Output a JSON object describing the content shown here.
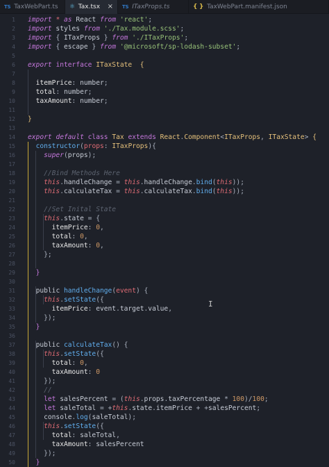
{
  "tabs": [
    {
      "name": "tab-taxwebpart",
      "icon": "ts-file-icon",
      "icon_text": "TS",
      "label": "TaxWebPart.ts",
      "active": false,
      "italic": false
    },
    {
      "name": "tab-tax-tsx",
      "icon": "react-file-icon",
      "icon_text": "⚛",
      "label": "Tax.tsx",
      "active": true,
      "italic": false,
      "close": "×"
    },
    {
      "name": "tab-itaxprops",
      "icon": "ts-file-icon",
      "icon_text": "TS",
      "label": "ITaxProps.ts",
      "active": false,
      "italic": true
    },
    {
      "name": "tab-manifest",
      "icon": "json-file-icon",
      "icon_text": "{ }",
      "label": "TaxWebPart.manifest.json",
      "active": false,
      "italic": false
    }
  ],
  "editor": {
    "line_numbers": [
      "1",
      "2",
      "3",
      "4",
      "5",
      "6",
      "7",
      "8",
      "9",
      "10",
      "11",
      "12",
      "13",
      "14",
      "15",
      "16",
      "17",
      "18",
      "19",
      "20",
      "21",
      "22",
      "23",
      "24",
      "25",
      "26",
      "27",
      "28",
      "29",
      "30",
      "31",
      "32",
      "33",
      "34",
      "35",
      "36",
      "37",
      "38",
      "39",
      "40",
      "41",
      "42",
      "43",
      "44",
      "45",
      "46",
      "47",
      "48",
      "49",
      "50"
    ],
    "lines": [
      [
        [
          "kwi",
          "import"
        ],
        [
          "pl",
          " "
        ],
        [
          "id",
          "*"
        ],
        [
          "pl",
          " "
        ],
        [
          "kwi",
          "as"
        ],
        [
          "pl",
          " React "
        ],
        [
          "kwi",
          "from"
        ],
        [
          "pl",
          " "
        ],
        [
          "str",
          "'react'"
        ],
        [
          "pun",
          ";"
        ]
      ],
      [
        [
          "kwi",
          "import"
        ],
        [
          "pl",
          " styles "
        ],
        [
          "kwi",
          "from"
        ],
        [
          "pl",
          " "
        ],
        [
          "str",
          "'./Tax.module.scss'"
        ],
        [
          "pun",
          ";"
        ]
      ],
      [
        [
          "kwi",
          "import"
        ],
        [
          "pl",
          " "
        ],
        [
          "pun",
          "{"
        ],
        [
          "pl",
          " ITaxProps "
        ],
        [
          "pun",
          "}"
        ],
        [
          "pl",
          " "
        ],
        [
          "kwi",
          "from"
        ],
        [
          "pl",
          " "
        ],
        [
          "str",
          "'./ITaxProps'"
        ],
        [
          "pun",
          ";"
        ]
      ],
      [
        [
          "kwi",
          "import"
        ],
        [
          "pl",
          " "
        ],
        [
          "pun",
          "{"
        ],
        [
          "pl",
          " escape "
        ],
        [
          "pun",
          "}"
        ],
        [
          "pl",
          " "
        ],
        [
          "kwi",
          "from"
        ],
        [
          "pl",
          " "
        ],
        [
          "str",
          "'@microsoft/sp-lodash-subset'"
        ],
        [
          "pun",
          ";"
        ]
      ],
      [],
      [
        [
          "kwi",
          "export"
        ],
        [
          "pl",
          " "
        ],
        [
          "kw",
          "interface"
        ],
        [
          "pl",
          " "
        ],
        [
          "ty",
          "ITaxState"
        ],
        [
          "pl",
          "  "
        ],
        [
          "ty",
          "{"
        ]
      ],
      [],
      [
        [
          "pl",
          "  "
        ],
        [
          "prop",
          "itemPrice"
        ],
        [
          "pun",
          ":"
        ],
        [
          "pl",
          " "
        ],
        [
          "pl",
          "number"
        ],
        [
          "pun",
          ";"
        ]
      ],
      [
        [
          "pl",
          "  "
        ],
        [
          "prop",
          "total"
        ],
        [
          "pun",
          ":"
        ],
        [
          "pl",
          " "
        ],
        [
          "pl",
          "number"
        ],
        [
          "pun",
          ";"
        ]
      ],
      [
        [
          "pl",
          "  "
        ],
        [
          "prop",
          "taxAmount"
        ],
        [
          "pun",
          ":"
        ],
        [
          "pl",
          " "
        ],
        [
          "pl",
          "number"
        ],
        [
          "pun",
          ";"
        ]
      ],
      [],
      [
        [
          "ty",
          "}"
        ]
      ],
      [],
      [
        [
          "kwi",
          "export"
        ],
        [
          "pl",
          " "
        ],
        [
          "kwi",
          "default"
        ],
        [
          "pl",
          " "
        ],
        [
          "kw",
          "class"
        ],
        [
          "pl",
          " "
        ],
        [
          "cls",
          "Tax"
        ],
        [
          "pl",
          " "
        ],
        [
          "kw",
          "extends"
        ],
        [
          "pl",
          " "
        ],
        [
          "cls",
          "React"
        ],
        [
          "pun",
          "."
        ],
        [
          "cls",
          "Component"
        ],
        [
          "pun",
          "<"
        ],
        [
          "cls",
          "ITaxProps"
        ],
        [
          "pun",
          ","
        ],
        [
          "pl",
          " "
        ],
        [
          "cls",
          "ITaxState"
        ],
        [
          "pun",
          ">"
        ],
        [
          "pl",
          " "
        ],
        [
          "ty",
          "{"
        ]
      ],
      [
        [
          "pl",
          "  "
        ],
        [
          "fn",
          "constructor"
        ],
        [
          "pun",
          "("
        ],
        [
          "par",
          "props"
        ],
        [
          "pun",
          ":"
        ],
        [
          "pl",
          " "
        ],
        [
          "cls",
          "ITaxProps"
        ],
        [
          "pun",
          "){"
        ]
      ],
      [
        [
          "pl",
          "    "
        ],
        [
          "kwi",
          "super"
        ],
        [
          "pun",
          "("
        ],
        [
          "pl",
          "props"
        ],
        [
          "pun",
          ");"
        ]
      ],
      [],
      [
        [
          "pl",
          "    "
        ],
        [
          "com",
          "//Bind Methods Here"
        ]
      ],
      [
        [
          "pl",
          "    "
        ],
        [
          "idi",
          "this"
        ],
        [
          "pun",
          "."
        ],
        [
          "pl",
          "handleChange "
        ],
        [
          "pun",
          "="
        ],
        [
          "pl",
          " "
        ],
        [
          "idi",
          "this"
        ],
        [
          "pun",
          "."
        ],
        [
          "pl",
          "handleChange"
        ],
        [
          "pun",
          "."
        ],
        [
          "fn",
          "bind"
        ],
        [
          "pun",
          "("
        ],
        [
          "idi",
          "this"
        ],
        [
          "pun",
          "));"
        ]
      ],
      [
        [
          "pl",
          "    "
        ],
        [
          "idi",
          "this"
        ],
        [
          "pun",
          "."
        ],
        [
          "pl",
          "calculateTax "
        ],
        [
          "pun",
          "="
        ],
        [
          "pl",
          " "
        ],
        [
          "idi",
          "this"
        ],
        [
          "pun",
          "."
        ],
        [
          "pl",
          "calculateTax"
        ],
        [
          "pun",
          "."
        ],
        [
          "fn",
          "bind"
        ],
        [
          "pun",
          "("
        ],
        [
          "idi",
          "this"
        ],
        [
          "pun",
          "));"
        ]
      ],
      [],
      [
        [
          "pl",
          "    "
        ],
        [
          "com",
          "//Set Inital State"
        ]
      ],
      [
        [
          "pl",
          "    "
        ],
        [
          "idi",
          "this"
        ],
        [
          "pun",
          "."
        ],
        [
          "pl",
          "state "
        ],
        [
          "pun",
          "= {"
        ]
      ],
      [
        [
          "pl",
          "      "
        ],
        [
          "prop",
          "itemPrice"
        ],
        [
          "pun",
          ":"
        ],
        [
          "pl",
          " "
        ],
        [
          "num",
          "0"
        ],
        [
          "pun",
          ","
        ]
      ],
      [
        [
          "pl",
          "      "
        ],
        [
          "prop",
          "total"
        ],
        [
          "pun",
          ":"
        ],
        [
          "pl",
          " "
        ],
        [
          "num",
          "0"
        ],
        [
          "pun",
          ","
        ]
      ],
      [
        [
          "pl",
          "      "
        ],
        [
          "prop",
          "taxAmount"
        ],
        [
          "pun",
          ":"
        ],
        [
          "pl",
          " "
        ],
        [
          "num",
          "0"
        ],
        [
          "pun",
          ","
        ]
      ],
      [
        [
          "pl",
          "    "
        ],
        [
          "pun",
          "};"
        ]
      ],
      [],
      [
        [
          "pl",
          "  "
        ],
        [
          "kw",
          "}"
        ]
      ],
      [],
      [
        [
          "pl",
          "  "
        ],
        [
          "pl",
          "public "
        ],
        [
          "fn",
          "handleChange"
        ],
        [
          "pun",
          "("
        ],
        [
          "par",
          "event"
        ],
        [
          "pun",
          ") {"
        ]
      ],
      [
        [
          "pl",
          "    "
        ],
        [
          "idi",
          "this"
        ],
        [
          "pun",
          "."
        ],
        [
          "fn",
          "setState"
        ],
        [
          "pun",
          "({"
        ]
      ],
      [
        [
          "pl",
          "      "
        ],
        [
          "prop",
          "itemPrice"
        ],
        [
          "pun",
          ":"
        ],
        [
          "pl",
          " event"
        ],
        [
          "pun",
          "."
        ],
        [
          "pl",
          "target"
        ],
        [
          "pun",
          "."
        ],
        [
          "pl",
          "value"
        ],
        [
          "pun",
          ","
        ]
      ],
      [
        [
          "pl",
          "    "
        ],
        [
          "pun",
          "});"
        ]
      ],
      [
        [
          "pl",
          "  "
        ],
        [
          "kw",
          "}"
        ]
      ],
      [],
      [
        [
          "pl",
          "  "
        ],
        [
          "pl",
          "public "
        ],
        [
          "fn",
          "calculateTax"
        ],
        [
          "pun",
          "() {"
        ]
      ],
      [
        [
          "pl",
          "    "
        ],
        [
          "idi",
          "this"
        ],
        [
          "pun",
          "."
        ],
        [
          "fn",
          "setState"
        ],
        [
          "pun",
          "({"
        ]
      ],
      [
        [
          "pl",
          "      "
        ],
        [
          "prop",
          "total"
        ],
        [
          "pun",
          ":"
        ],
        [
          "pl",
          " "
        ],
        [
          "num",
          "0"
        ],
        [
          "pun",
          ","
        ]
      ],
      [
        [
          "pl",
          "      "
        ],
        [
          "prop",
          "taxAmount"
        ],
        [
          "pun",
          ":"
        ],
        [
          "pl",
          " "
        ],
        [
          "num",
          "0"
        ]
      ],
      [
        [
          "pl",
          "    "
        ],
        [
          "pun",
          "});"
        ]
      ],
      [
        [
          "pl",
          "    "
        ],
        [
          "com",
          "//"
        ]
      ],
      [
        [
          "pl",
          "    "
        ],
        [
          "kw",
          "let"
        ],
        [
          "pl",
          " salesPercent "
        ],
        [
          "pun",
          "="
        ],
        [
          "pl",
          " "
        ],
        [
          "pun",
          "("
        ],
        [
          "idi",
          "this"
        ],
        [
          "pun",
          "."
        ],
        [
          "pl",
          "props"
        ],
        [
          "pun",
          "."
        ],
        [
          "pl",
          "taxPercentage "
        ],
        [
          "pun",
          "*"
        ],
        [
          "pl",
          " "
        ],
        [
          "num",
          "100"
        ],
        [
          "pun",
          ")/"
        ],
        [
          "num",
          "100"
        ],
        [
          "pun",
          ";"
        ]
      ],
      [
        [
          "pl",
          "    "
        ],
        [
          "kw",
          "let"
        ],
        [
          "pl",
          " saleTotal "
        ],
        [
          "pun",
          "="
        ],
        [
          "pl",
          " "
        ],
        [
          "pun",
          "+"
        ],
        [
          "idi",
          "this"
        ],
        [
          "pun",
          "."
        ],
        [
          "pl",
          "state"
        ],
        [
          "pun",
          "."
        ],
        [
          "pl",
          "itemPrice "
        ],
        [
          "pun",
          "+"
        ],
        [
          "pl",
          " "
        ],
        [
          "pun",
          "+"
        ],
        [
          "pl",
          "salesPercent"
        ],
        [
          "pun",
          ";"
        ]
      ],
      [
        [
          "pl",
          "    "
        ],
        [
          "pl",
          "console"
        ],
        [
          "pun",
          "."
        ],
        [
          "fn",
          "log"
        ],
        [
          "pun",
          "("
        ],
        [
          "pl",
          "saleTotal"
        ],
        [
          "pun",
          ");"
        ]
      ],
      [
        [
          "pl",
          "    "
        ],
        [
          "idi",
          "this"
        ],
        [
          "pun",
          "."
        ],
        [
          "fn",
          "setState"
        ],
        [
          "pun",
          "({"
        ]
      ],
      [
        [
          "pl",
          "      "
        ],
        [
          "prop",
          "total"
        ],
        [
          "pun",
          ":"
        ],
        [
          "pl",
          " saleTotal"
        ],
        [
          "pun",
          ","
        ]
      ],
      [
        [
          "pl",
          "      "
        ],
        [
          "prop",
          "taxAmount"
        ],
        [
          "pun",
          ":"
        ],
        [
          "pl",
          " salesPercent"
        ]
      ],
      [
        [
          "pl",
          "    "
        ],
        [
          "pun",
          "});"
        ]
      ],
      [
        [
          "pl",
          "  "
        ],
        [
          "kw",
          "}"
        ]
      ]
    ]
  }
}
